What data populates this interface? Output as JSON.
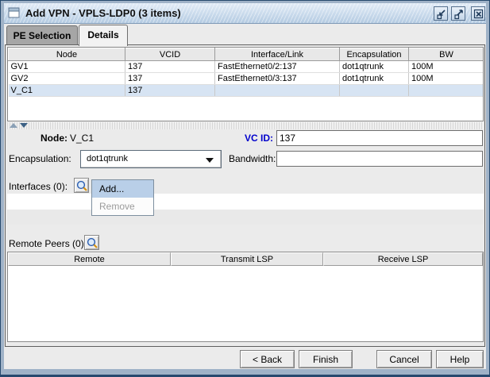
{
  "window": {
    "title": "Add VPN - VPLS-LDP0 (3 items)"
  },
  "tabs": {
    "pe_selection": "PE Selection",
    "details": "Details"
  },
  "pe_table": {
    "columns": [
      "Node",
      "VCID",
      "Interface/Link",
      "Encapsulation",
      "BW"
    ],
    "rows": [
      {
        "node": "GV1",
        "vcid": "137",
        "interface": "FastEthernet0/2:137",
        "encapsulation": "dot1qtrunk",
        "bw": "100M"
      },
      {
        "node": "GV2",
        "vcid": "137",
        "interface": "FastEthernet0/3:137",
        "encapsulation": "dot1qtrunk",
        "bw": "100M"
      },
      {
        "node": "V_C1",
        "vcid": "137",
        "interface": "",
        "encapsulation": "",
        "bw": ""
      }
    ],
    "selected_row": "V_C1"
  },
  "form": {
    "node_label": "Node:",
    "node_value": "V_C1",
    "vcid_label": "VC ID:",
    "vcid_value": "137",
    "encapsulation_label": "Encapsulation:",
    "encapsulation_value": "dot1qtrunk",
    "bandwidth_label": "Bandwidth:",
    "bandwidth_value": "",
    "interfaces_label": "Interfaces (0):",
    "remote_peers_label": "Remote Peers (0):"
  },
  "interfaces_menu": {
    "add": "Add...",
    "remove": "Remove"
  },
  "remote_table": {
    "columns": [
      "Remote",
      "Transmit LSP",
      "Receive LSP"
    ]
  },
  "footer": {
    "back": "< Back",
    "finish": "Finish",
    "cancel": "Cancel",
    "help": "Help"
  },
  "icons": {
    "titlebar_left": "window-icon",
    "controls": [
      "minimize-icon",
      "maximize-icon",
      "close-icon"
    ],
    "interfaces_lookup": "magnifier-icon",
    "remote_peers_lookup": "magnifier-icon",
    "combo": "chevron-down-icon",
    "splitter": [
      "triangle-up-icon",
      "triangle-down-icon"
    ]
  },
  "colors": {
    "vcid_label_blue": "#0000CC",
    "selected_row": "#D7E4F3",
    "menu_highlight": "#B9CFE8",
    "titlebar_blue": "#C9DBEE",
    "frame_blue": "#9FB2C7"
  }
}
